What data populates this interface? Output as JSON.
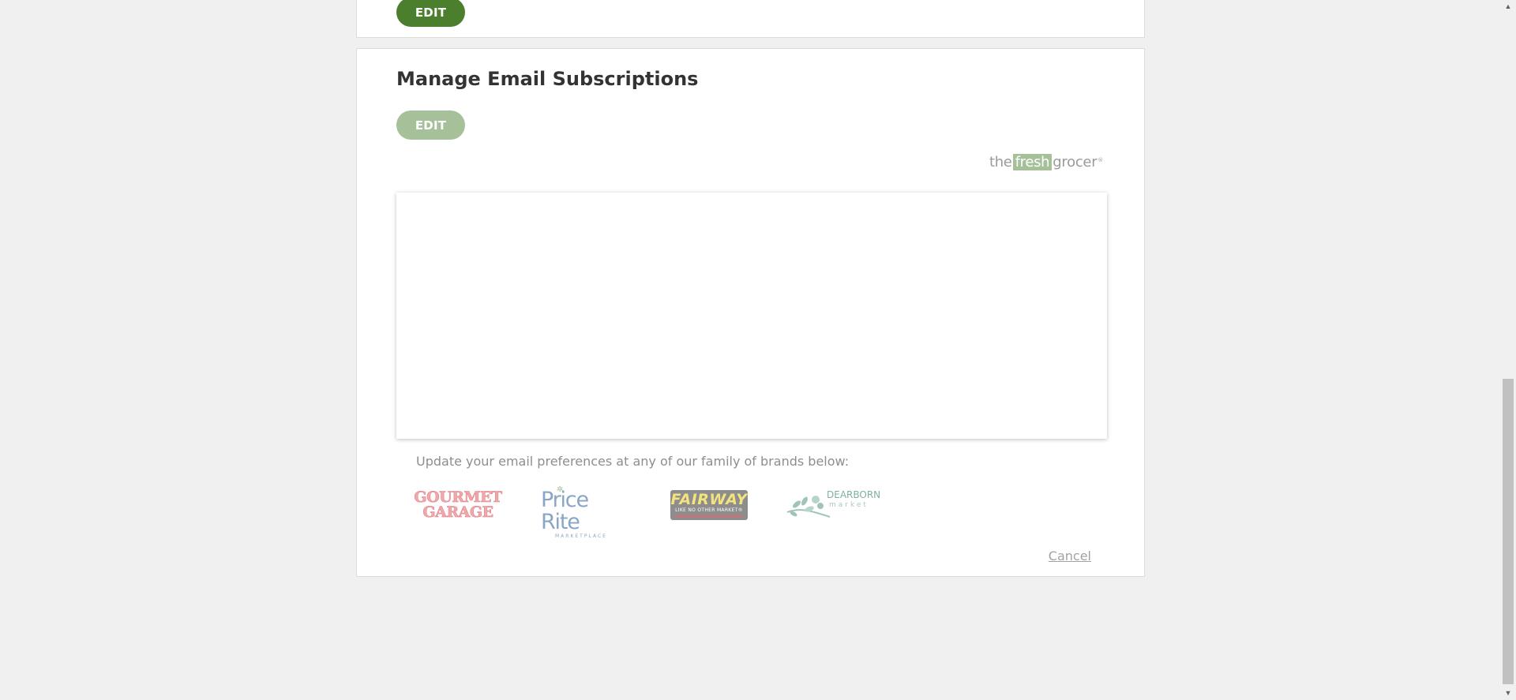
{
  "top_section": {
    "edit_label": "EDIT"
  },
  "email_section": {
    "title": "Manage Email Subscriptions",
    "edit_label": "EDIT",
    "brand_logo": {
      "prefix": "the",
      "highlight": "fresh",
      "suffix": "grocer",
      "mark": "®"
    },
    "preferences_text": "Update your email preferences at any of our family of brands below:",
    "brands": {
      "gourmet_garage": {
        "line1": "GOURMET",
        "line2": "GARAGE"
      },
      "price_rite": {
        "name": "Price Rite",
        "sub": "MARKETPLACE"
      },
      "fairway": {
        "name": "FAIRWAY",
        "tagline": "LIKE NO OTHER MARKET®"
      },
      "dearborn": {
        "name": "DEARBORN",
        "sub": "market"
      }
    },
    "cancel_label": "Cancel"
  },
  "colors": {
    "edit_active": "#4b7f2d",
    "edit_disabled": "#a6c19a",
    "page_background": "#f0f0f0"
  },
  "scrollbar": {
    "up_icon": "▲",
    "down_icon": "▼"
  }
}
